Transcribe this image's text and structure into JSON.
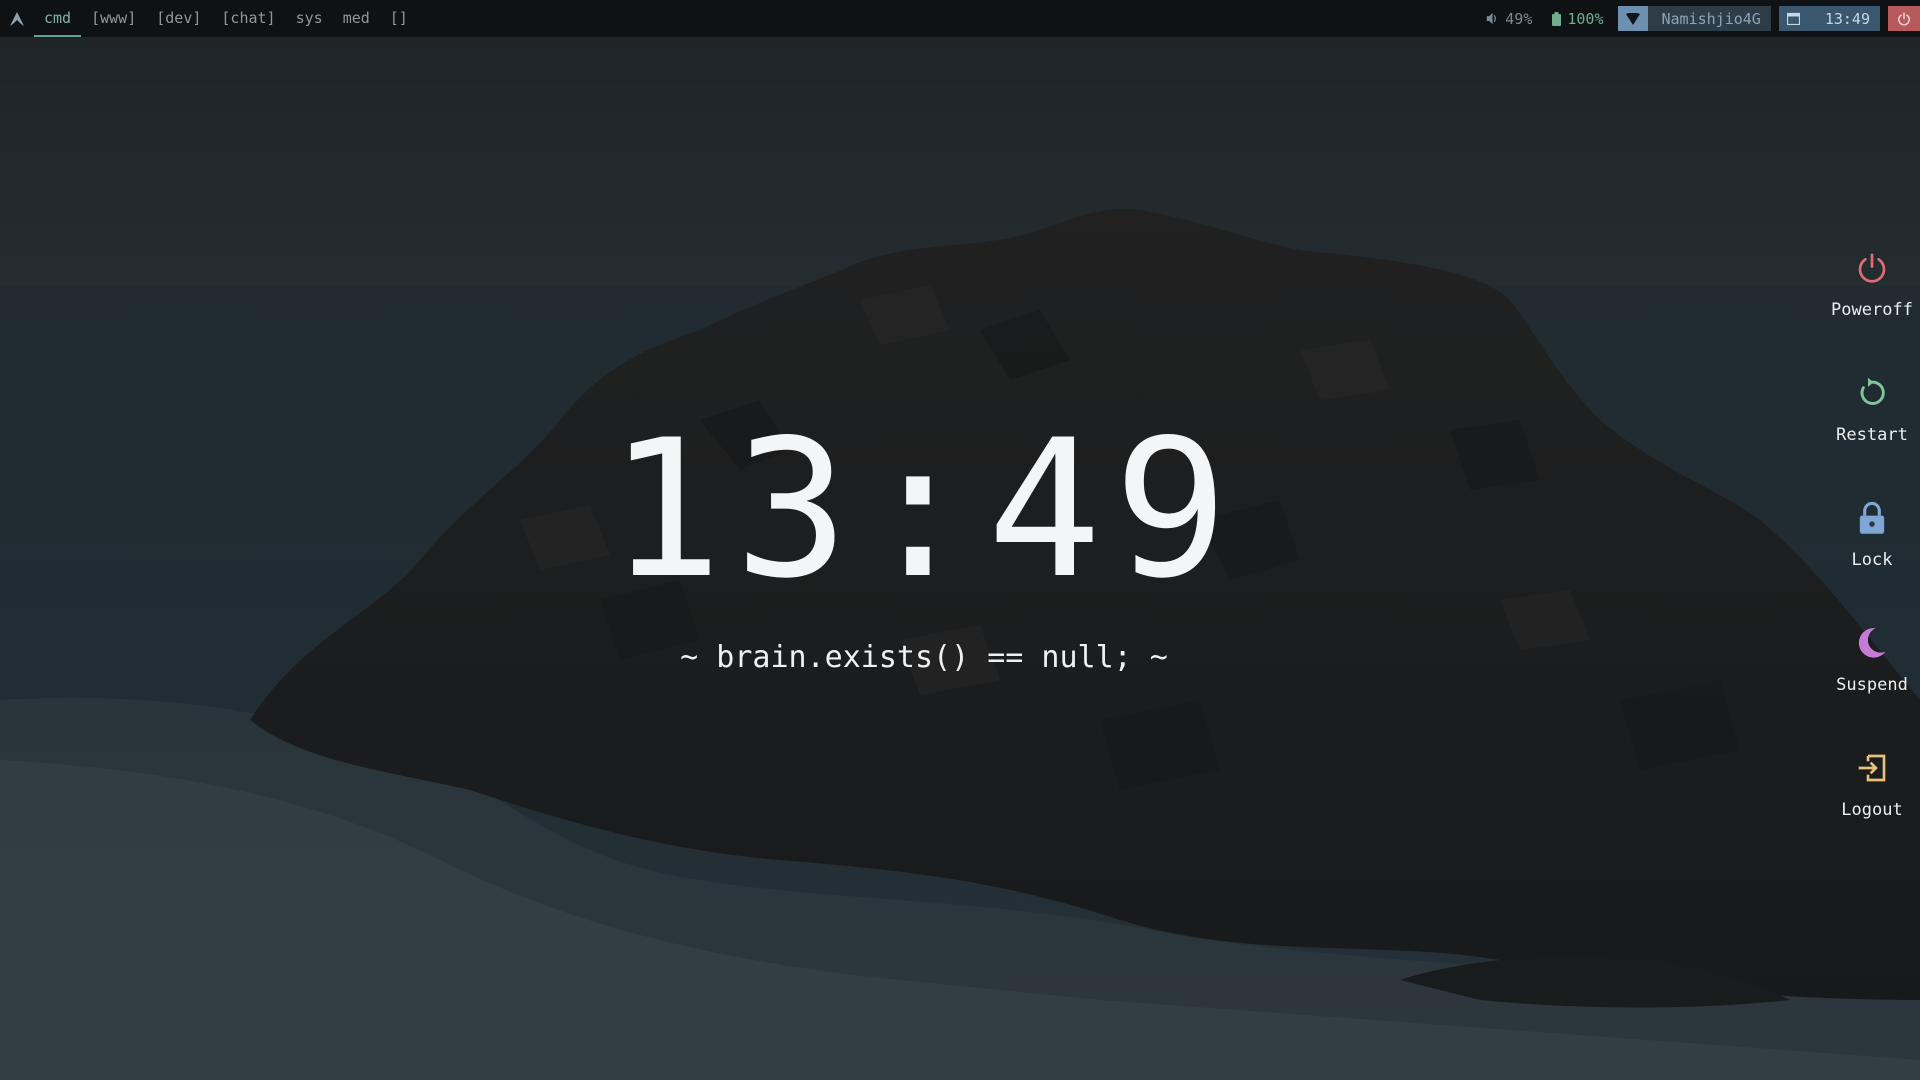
{
  "topbar": {
    "launcher_icon": "arch-logo-icon",
    "workspaces": [
      {
        "label": "cmd",
        "active": true
      },
      {
        "label": "[www]",
        "active": false
      },
      {
        "label": "[dev]",
        "active": false
      },
      {
        "label": "[chat]",
        "active": false
      },
      {
        "label": "sys",
        "active": false
      },
      {
        "label": "med",
        "active": false
      },
      {
        "label": "[]",
        "active": false
      }
    ],
    "volume": {
      "icon": "speaker-icon",
      "value": "49%"
    },
    "battery": {
      "icon": "battery-icon",
      "value": "100%"
    },
    "network": {
      "icon": "wifi-icon",
      "ssid": "Namishjio4G"
    },
    "clock": {
      "icon": "calendar-icon",
      "time": "13:49"
    },
    "power_icon": "power-icon"
  },
  "lockscreen": {
    "time": "13:49",
    "tagline": "~ brain.exists() == null; ~"
  },
  "power_menu": [
    {
      "label": "Poweroff",
      "icon": "power-icon",
      "color": "#e06c75"
    },
    {
      "label": "Restart",
      "icon": "restart-icon",
      "color": "#7ec699"
    },
    {
      "label": "Lock",
      "icon": "lock-icon",
      "color": "#7fa6d6"
    },
    {
      "label": "Suspend",
      "icon": "moon-icon",
      "color": "#c67bd6"
    },
    {
      "label": "Logout",
      "icon": "logout-icon",
      "color": "#e5c07b"
    }
  ],
  "colors": {
    "bar_bg": "#0f1214",
    "active_ws": "#7fb3a6",
    "network_bg": "#2e3c48",
    "clock_bg": "#3b5770",
    "power_bg": "#b75a5e"
  }
}
